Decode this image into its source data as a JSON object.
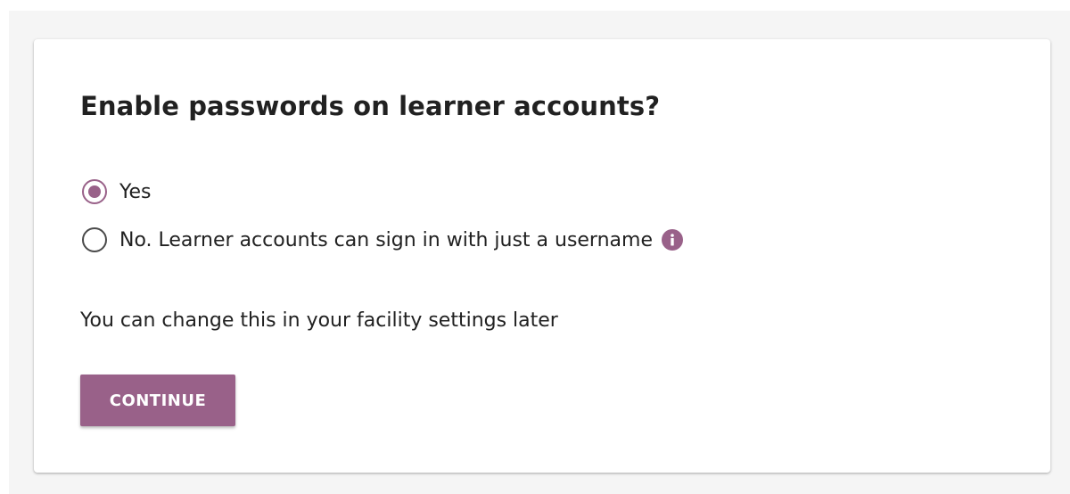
{
  "card": {
    "title": "Enable passwords on learner accounts?",
    "options": [
      {
        "label": "Yes",
        "selected": true
      },
      {
        "label": "No. Learner accounts can sign in with just a username",
        "selected": false,
        "has_info_icon": true
      }
    ],
    "helper_text": "You can change this in your facility settings later",
    "continue_label": "CONTINUE"
  },
  "icons": {
    "info": "info-icon"
  },
  "colors": {
    "accent": "#996189",
    "background": "#f5f5f5",
    "card": "#ffffff",
    "text": "#212121"
  }
}
